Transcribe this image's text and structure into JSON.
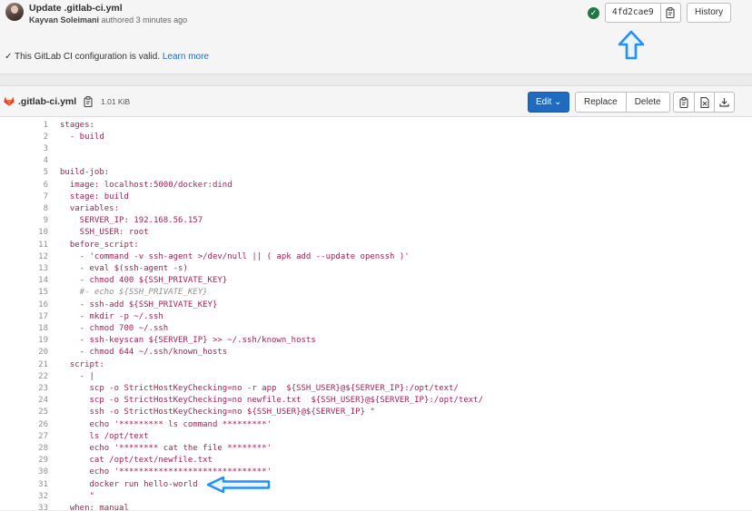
{
  "commit": {
    "title": "Update .gitlab-ci.yml",
    "author": "Kayvan Soleimani",
    "meta_rest": " authored 3 minutes ago",
    "sha": "4fd2cae9",
    "history_label": "History"
  },
  "ci_status": {
    "text": "This GitLab CI configuration is valid.",
    "link": "Learn more"
  },
  "file": {
    "name": ".gitlab-ci.yml",
    "size": "1.01 KiB",
    "edit_label": "Edit",
    "replace_label": "Replace",
    "delete_label": "Delete"
  },
  "code_lines": [
    "stages:",
    "  - build",
    "",
    "",
    "build-job:",
    "  image: localhost:5000/docker:dind",
    "  stage: build",
    "  variables:",
    "    SERVER_IP: 192.168.56.157",
    "    SSH_USER: root",
    "  before_script:",
    "    - 'command -v ssh-agent >/dev/null || ( apk add --update openssh )'",
    "    - eval $(ssh-agent -s)",
    "    - chmod 400 ${SSH_PRIVATE_KEY}",
    "    #- echo ${SSH_PRIVATE_KEY}",
    "    - ssh-add ${SSH_PRIVATE_KEY}",
    "    - mkdir -p ~/.ssh",
    "    - chmod 700 ~/.ssh",
    "    - ssh-keyscan ${SERVER_IP} >> ~/.ssh/known_hosts",
    "    - chmod 644 ~/.ssh/known_hosts",
    "  script:",
    "    - |",
    "      scp -o StrictHostKeyChecking=no -r app  ${SSH_USER}@${SERVER_IP}:/opt/text/",
    "      scp -o StrictHostKeyChecking=no newfile.txt  ${SSH_USER}@${SERVER_IP}:/opt/text/",
    "      ssh -o StrictHostKeyChecking=no ${SSH_USER}@${SERVER_IP} \"",
    "      echo '********* ls command *********'",
    "      ls /opt/text",
    "      echo '******** cat the file ********'",
    "      cat /opt/text/newfile.txt",
    "      echo '******************************'",
    "      docker run hello-world",
    "      \"",
    "  when: manual"
  ],
  "colors": {
    "accent": "#1f6bc2",
    "success": "#217645",
    "code_value": "#a3215a",
    "annotation_arrow": "#1e90ff"
  }
}
